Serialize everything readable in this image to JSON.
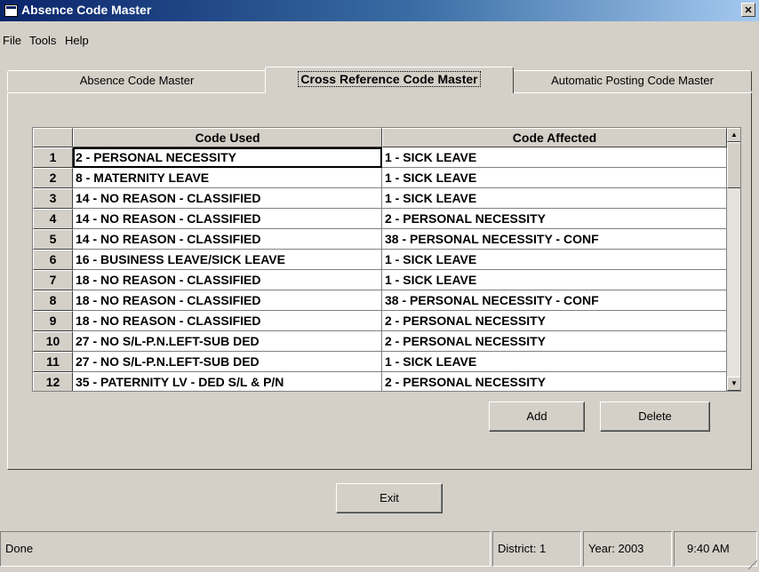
{
  "window": {
    "title": "Absence Code Master",
    "close_glyph": "✕"
  },
  "menu": [
    "File",
    "Tools",
    "Help"
  ],
  "tabs": [
    {
      "label": "Absence Code Master",
      "active": false
    },
    {
      "label": "Cross Reference Code Master",
      "active": true
    },
    {
      "label": "Automatic Posting Code Master",
      "active": false
    }
  ],
  "grid": {
    "columns": [
      "Code Used",
      "Code Affected"
    ],
    "rows": [
      {
        "num": "1",
        "used": "2 - PERSONAL NECESSITY",
        "affected": "1 - SICK LEAVE"
      },
      {
        "num": "2",
        "used": "8 - MATERNITY LEAVE",
        "affected": "1 - SICK LEAVE"
      },
      {
        "num": "3",
        "used": "14 - NO REASON - CLASSIFIED",
        "affected": "1 - SICK LEAVE"
      },
      {
        "num": "4",
        "used": "14 - NO REASON - CLASSIFIED",
        "affected": "2 - PERSONAL NECESSITY"
      },
      {
        "num": "5",
        "used": "14 - NO REASON - CLASSIFIED",
        "affected": "38 - PERSONAL NECESSITY - CONF"
      },
      {
        "num": "6",
        "used": "16 - BUSINESS LEAVE/SICK LEAVE",
        "affected": "1 - SICK LEAVE"
      },
      {
        "num": "7",
        "used": "18 - NO REASON - CLASSIFIED",
        "affected": "1 - SICK LEAVE"
      },
      {
        "num": "8",
        "used": "18 - NO REASON - CLASSIFIED",
        "affected": "38 - PERSONAL NECESSITY - CONF"
      },
      {
        "num": "9",
        "used": "18 - NO REASON - CLASSIFIED",
        "affected": "2 - PERSONAL NECESSITY"
      },
      {
        "num": "10",
        "used": "27 - NO S/L-P.N.LEFT-SUB DED",
        "affected": "2 - PERSONAL NECESSITY"
      },
      {
        "num": "11",
        "used": "27 - NO S/L-P.N.LEFT-SUB DED",
        "affected": "1 - SICK LEAVE"
      },
      {
        "num": "12",
        "used": "35 - PATERNITY LV - DED S/L & P/N",
        "affected": "2 - PERSONAL NECESSITY"
      }
    ],
    "scroll_up_glyph": "▲",
    "scroll_down_glyph": "▼"
  },
  "buttons": {
    "add": "Add",
    "delete": "Delete",
    "exit": "Exit"
  },
  "status": {
    "message": "Done",
    "district": "District: 1",
    "year": "Year: 2003",
    "time": "9:40 AM"
  },
  "icons": {
    "app": "app-window-icon",
    "close": "close-icon",
    "grip": "resize-grip-icon"
  },
  "colors": {
    "title_start": "#0a246a",
    "title_end": "#a6caf0",
    "face": "#d4d0c8"
  }
}
